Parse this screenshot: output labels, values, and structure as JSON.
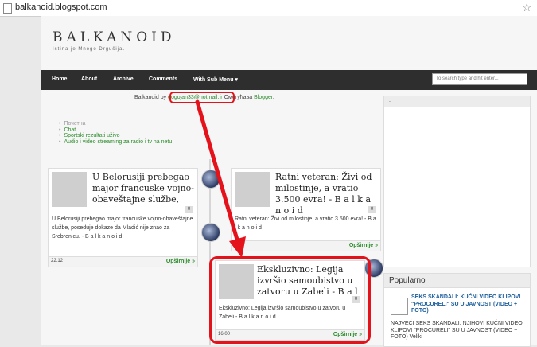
{
  "browser": {
    "url": "balkanoid.blogspot.com"
  },
  "blog": {
    "title": "BALKANOID",
    "tagline": "Istina je Mnogo Drgušija."
  },
  "nav": {
    "items": [
      "Home",
      "About",
      "Archive",
      "Comments",
      "With Sub Menu ▾"
    ],
    "search_placeholder": "To search type and hit enter..."
  },
  "attribution": {
    "prefix": "Balkanoid by",
    "email": "gogojan33@hotmail.fr",
    "middle": " Омогућава ",
    "provider": "Blogger",
    "suffix": "."
  },
  "links": [
    "Почетна",
    "Chat",
    "Sportski rezultati uživo",
    "Audio i video streaming za radio i tv na netu"
  ],
  "posts": [
    {
      "title": "U Belorusiji prebegao major francuske vojno-obaveštajne službe,",
      "snippet": "U Belorusiji prebegao major francuske vojno-obaveštajne službe, poseduje dokaze da Mladić nije znao za Srebrenicu. - B a l k a n o i d",
      "count": "0",
      "date": "22.12",
      "more": "Opširnije »"
    },
    {
      "title": "Ratni veteran: Živi od milostinje, a vratio 3.500 evra! - B a l k a n o i d",
      "snippet": "Ratni veteran: Živi od milostinje, a vratio 3.500 evra! - B a l k a n o i d",
      "count": "0",
      "date": "",
      "more": "Opširnije »"
    },
    {
      "title": "Ekskluzivno: Legija izvršio samoubistvo u zatvoru u Zabeli - B a l k",
      "snippet": "Ekskluzivno: Legija izvršio samoubistvo u zatvoru u Zabeli - B a l k a n o i d",
      "count": "0",
      "date": "16.00",
      "more": "Opširnije »"
    }
  ],
  "sidebar": {
    "top_heading": ".",
    "popular_heading": "Popularno",
    "popular_title": "SEKS SKANDALI: KUĆNI VIDEO KLIPOVI \"PROCURELI\" SU U JAVNOST (VIDEO + FOTO)",
    "popular_snippet": "NAJVEĆI SEKS SKANDALI: NJIHOVI KUĆNI VIDEO KLIPOVI \"PROCURELI\" SU U JAVNOST (VIDEO + FOTO) Veliki"
  },
  "colors": {
    "highlight": "#e3121b",
    "link_green": "#2a8a2a",
    "nav_bg": "#2e2e2e"
  }
}
